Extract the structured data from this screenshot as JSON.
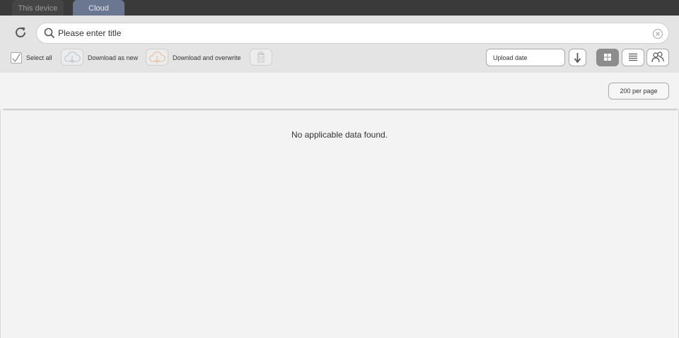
{
  "tabs": [
    {
      "label": "This device",
      "active": false
    },
    {
      "label": "Cloud",
      "active": true
    }
  ],
  "search": {
    "placeholder": "Please enter title",
    "value": ""
  },
  "toolbar": {
    "select_all_label": "Select all",
    "download_new_label": "Download as new",
    "download_overwrite_label": "Download and overwrite",
    "sort_by": "Upload date",
    "per_page": "200 per page"
  },
  "main": {
    "empty_message": "No applicable data found."
  },
  "icons": [
    "refresh-icon",
    "search-icon",
    "clear-icon",
    "cloud-download-icon",
    "trash-icon",
    "sort-descending-icon",
    "grid-view-icon",
    "list-view-icon",
    "people-icon"
  ],
  "colors": {
    "tab_active": "#6b7691",
    "tabbar": "#3a3a3a",
    "toolbar": "#e4e4e4",
    "view_active": "#8c8c8c"
  }
}
